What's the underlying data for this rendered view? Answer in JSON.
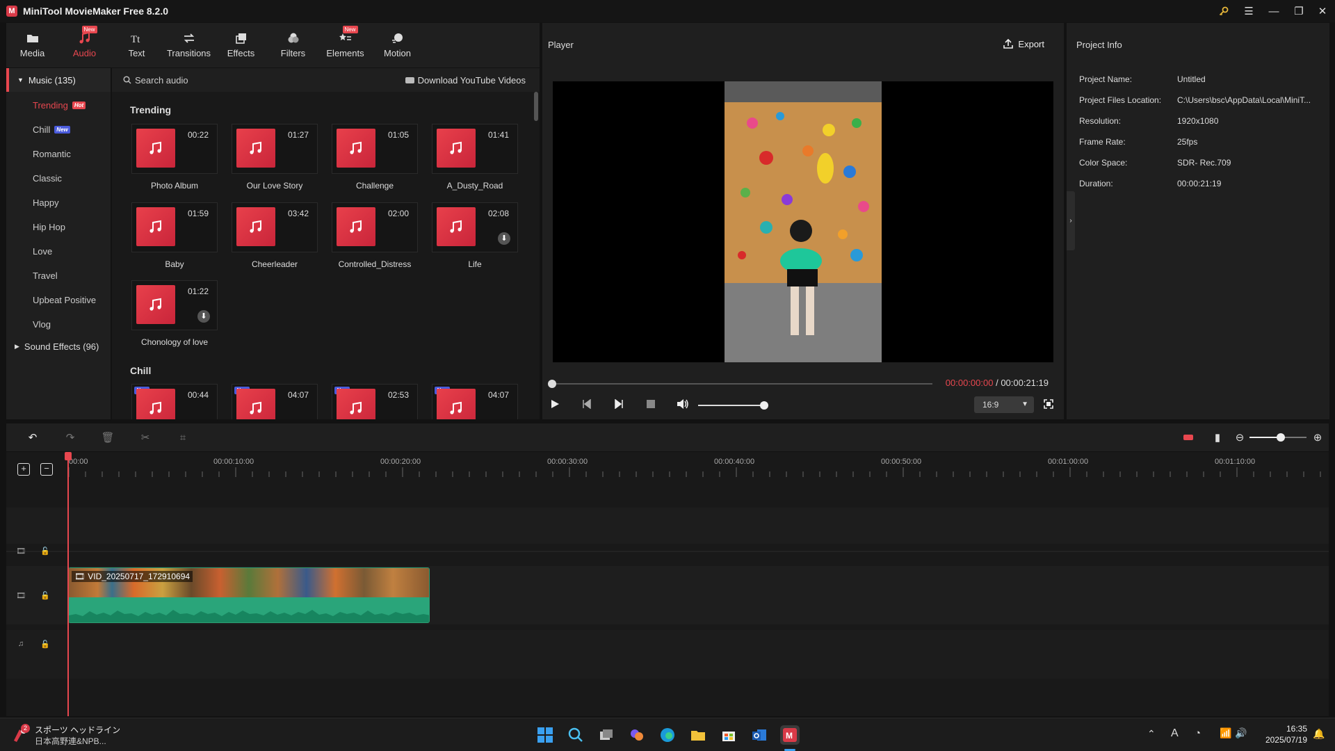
{
  "window": {
    "title": "MiniTool MovieMaker Free 8.2.0"
  },
  "toolbar": {
    "items": [
      {
        "label": "Media",
        "icon": "folder-icon"
      },
      {
        "label": "Audio",
        "icon": "music-note-icon",
        "badge": "New"
      },
      {
        "label": "Text",
        "icon": "text-icon"
      },
      {
        "label": "Transitions",
        "icon": "transitions-icon"
      },
      {
        "label": "Effects",
        "icon": "effects-icon"
      },
      {
        "label": "Filters",
        "icon": "filters-icon"
      },
      {
        "label": "Elements",
        "icon": "elements-icon",
        "badge": "New"
      },
      {
        "label": "Motion",
        "icon": "motion-icon"
      }
    ],
    "active": "Audio"
  },
  "categories": {
    "music_header": "Music (135)",
    "items": [
      {
        "label": "Trending",
        "tag": "Hot"
      },
      {
        "label": "Chill",
        "tag": "New"
      },
      {
        "label": "Romantic"
      },
      {
        "label": "Classic"
      },
      {
        "label": "Happy"
      },
      {
        "label": "Hip Hop"
      },
      {
        "label": "Love"
      },
      {
        "label": "Travel"
      },
      {
        "label": "Upbeat Positive"
      },
      {
        "label": "Vlog"
      }
    ],
    "sound_effects": "Sound Effects (96)"
  },
  "audio": {
    "search_label": "Search audio",
    "youtube_link": "Download YouTube Videos",
    "sections": [
      {
        "title": "Trending",
        "tracks": [
          {
            "name": "Photo Album",
            "duration": "00:22"
          },
          {
            "name": "Our Love Story",
            "duration": "01:27"
          },
          {
            "name": "Challenge",
            "duration": "01:05"
          },
          {
            "name": "A_Dusty_Road",
            "duration": "01:41"
          },
          {
            "name": "Baby",
            "duration": "01:59"
          },
          {
            "name": "Cheerleader",
            "duration": "03:42"
          },
          {
            "name": "Controlled_Distress",
            "duration": "02:00"
          },
          {
            "name": "Life",
            "duration": "02:08",
            "download": true
          },
          {
            "name": "Chonology of love",
            "duration": "01:22",
            "download": true
          }
        ]
      },
      {
        "title": "Chill",
        "tracks": [
          {
            "duration": "00:44",
            "tag": "New"
          },
          {
            "duration": "04:07",
            "tag": "New"
          },
          {
            "duration": "02:53",
            "tag": "New"
          },
          {
            "duration": "04:07",
            "tag": "New"
          }
        ]
      }
    ]
  },
  "player": {
    "title": "Player",
    "export_label": "Export",
    "current_time": "00:00:00:00",
    "separator": " / ",
    "total_time": "00:00:21:19",
    "aspect_ratio": "16:9",
    "volume": 1.0,
    "progress": 0.0
  },
  "project_info": {
    "title": "Project Info",
    "rows": [
      {
        "key": "Project Name:",
        "value": "Untitled"
      },
      {
        "key": "Project Files Location:",
        "value": "C:\\Users\\bsc\\AppData\\Local\\MiniT..."
      },
      {
        "key": "Resolution:",
        "value": "1920x1080"
      },
      {
        "key": "Frame Rate:",
        "value": "25fps"
      },
      {
        "key": "Color Space:",
        "value": "SDR- Rec.709"
      },
      {
        "key": "Duration:",
        "value": "00:00:21:19"
      }
    ]
  },
  "timeline": {
    "ticks": [
      "00:00",
      "00:00:10:00",
      "00:00:20:00",
      "00:00:30:00",
      "00:00:40:00",
      "00:00:50:00",
      "00:01:00:00",
      "00:01:10:00"
    ],
    "zoom": 0.55,
    "clip_name": "VID_20250717_172910694"
  },
  "taskbar": {
    "news_title": "スポーツ ヘッドライン",
    "news_sub": "日本高野連&NPB...",
    "news_badge": "2",
    "time": "16:35",
    "date": "2025/07/19",
    "ime": "A"
  },
  "colors": {
    "accent": "#e8474f",
    "panel": "#1f1f1f",
    "audio_wave": "#2aa57a",
    "new_tag": "#4a5bdc"
  }
}
